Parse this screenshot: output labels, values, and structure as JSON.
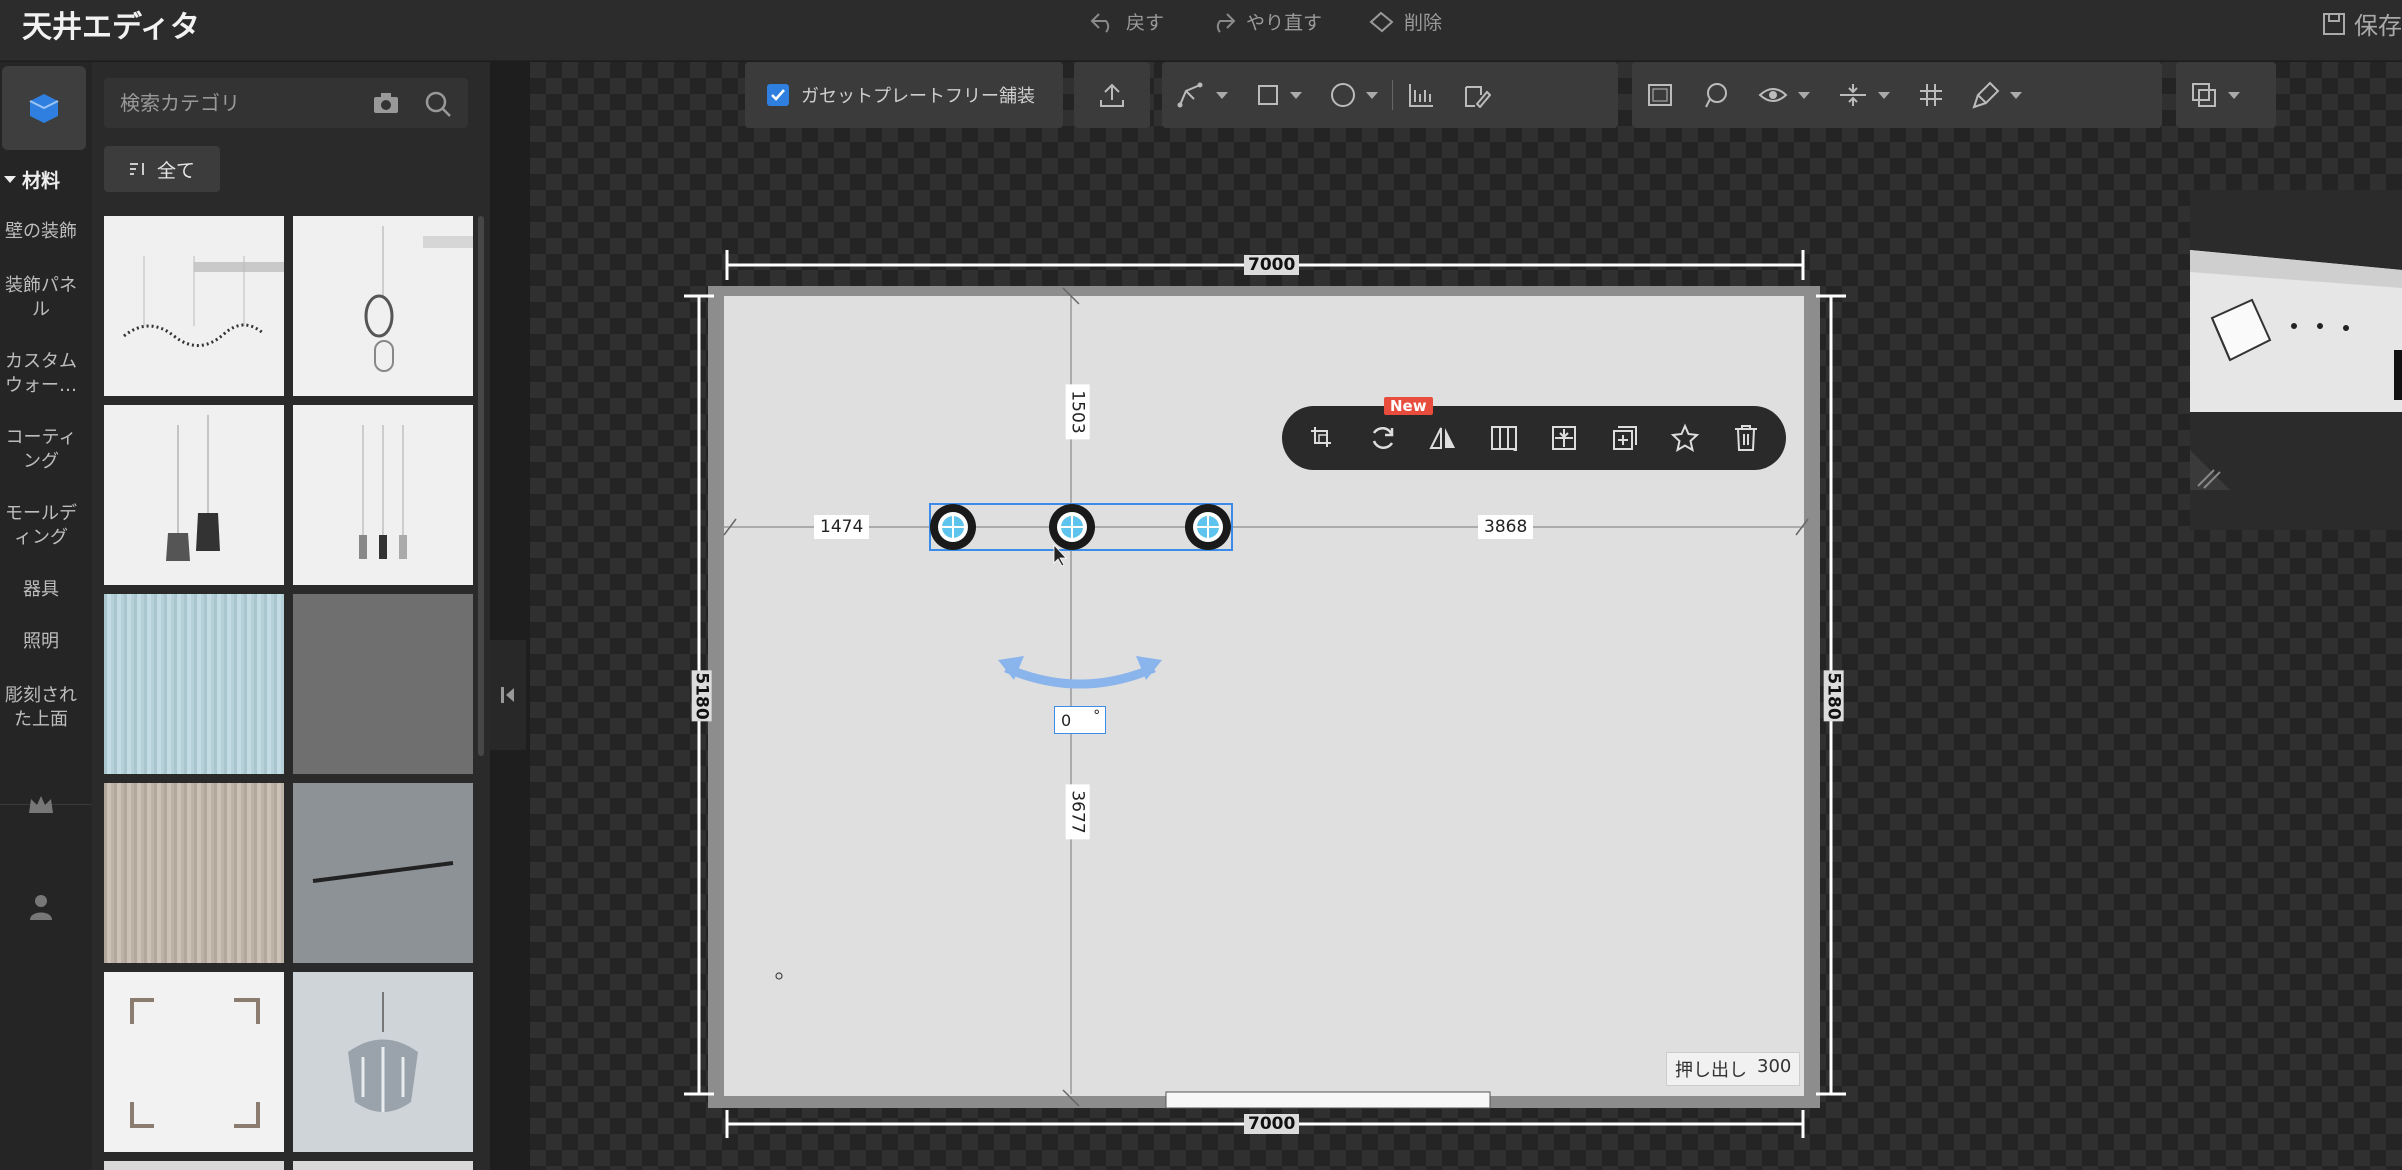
{
  "app": {
    "title": "天井エディタ"
  },
  "top_actions": {
    "undo": "戻す",
    "redo": "やり直す",
    "delete": "削除",
    "save": "保存"
  },
  "search": {
    "placeholder": "検索カテゴリ"
  },
  "filter": {
    "label": "全て"
  },
  "nav": {
    "section": "材料",
    "items": [
      "壁の装飾",
      "装飾パネル",
      "カスタムウォー…",
      "コーティング",
      "モールディング",
      "器具",
      "照明",
      "彫刻された上面"
    ]
  },
  "catalog": {
    "items": [
      {
        "name": "wave-chandelier"
      },
      {
        "name": "ring-pendant"
      },
      {
        "name": "double-pendant"
      },
      {
        "name": "triple-pendant"
      },
      {
        "name": "light-blue-wood"
      },
      {
        "name": "grey-plain"
      },
      {
        "name": "beige-wood"
      },
      {
        "name": "track-light"
      },
      {
        "name": "corner-frame"
      },
      {
        "name": "crystal-chandelier"
      }
    ]
  },
  "toolbar": {
    "gusset_label": "ガセットプレートフリー舗装",
    "gusset_checked": true
  },
  "floating_toolbar": {
    "new_badge": "New"
  },
  "dimensions": {
    "top": "7000",
    "bottom": "7000",
    "left": "5180",
    "right": "5180",
    "vertical_top": "1503",
    "vertical_bottom": "3677",
    "horizontal_left": "1474",
    "horizontal_right": "3868"
  },
  "rotation": {
    "value": "0",
    "unit": "°"
  },
  "extrude": {
    "label": "押し出し",
    "value": "300"
  },
  "colors": {
    "accent": "#2f7fe0",
    "badge": "#e74c3c",
    "selection": "#3b8be8"
  }
}
